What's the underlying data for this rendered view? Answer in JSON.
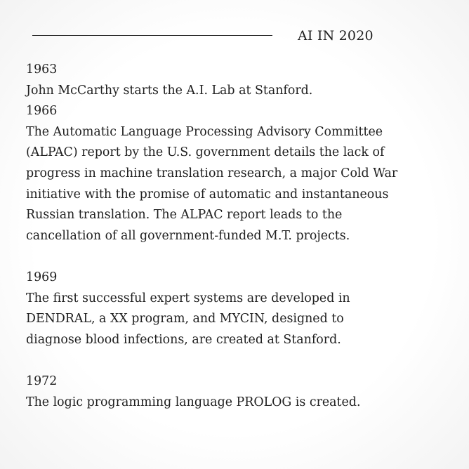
{
  "header": {
    "title": "AI IN 2020"
  },
  "entries": [
    {
      "year": "1963",
      "text": "John McCarthy starts the A.I. Lab at Stanford."
    },
    {
      "year": "1966",
      "text": "The Automatic Language Processing Advisory Committee\n(ALPAC) report by the U.S. government details the lack of\nprogress in machine translation research, a major Cold War\ninitiative with the promise of automatic and instantaneous\nRussian translation. The ALPAC report leads to the\ncancellation of all government-funded M.T. projects."
    },
    {
      "year": "1969",
      "text": "The first successful expert systems are developed in\nDENDRAL, a XX program, and MYCIN, designed to\ndiagnose blood infections, are created at Stanford."
    },
    {
      "year": "1972",
      "text": "The logic programming language PROLOG is created."
    }
  ]
}
